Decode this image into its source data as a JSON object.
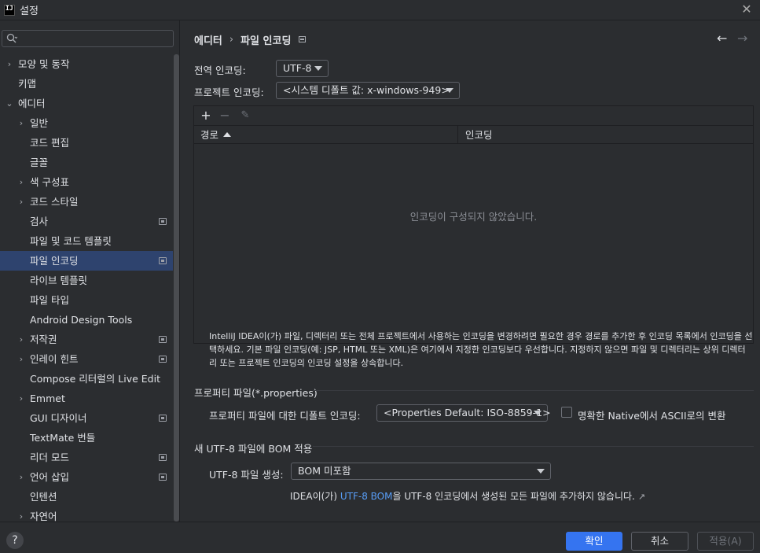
{
  "window": {
    "title": "설정"
  },
  "sidebar": {
    "search_placeholder": "",
    "items": [
      {
        "label": "모양 및 동작",
        "level": 0,
        "chevron": "›",
        "mark": false,
        "selected": false
      },
      {
        "label": "키맵",
        "level": 0,
        "chevron": "",
        "mark": false,
        "selected": false
      },
      {
        "label": "에디터",
        "level": 0,
        "chevron": "⌄",
        "mark": false,
        "selected": false
      },
      {
        "label": "일반",
        "level": 1,
        "chevron": "›",
        "mark": false,
        "selected": false
      },
      {
        "label": "코드 편집",
        "level": 1,
        "chevron": "",
        "mark": false,
        "selected": false
      },
      {
        "label": "글꼴",
        "level": 1,
        "chevron": "",
        "mark": false,
        "selected": false
      },
      {
        "label": "색 구성표",
        "level": 1,
        "chevron": "›",
        "mark": false,
        "selected": false
      },
      {
        "label": "코드 스타일",
        "level": 1,
        "chevron": "›",
        "mark": false,
        "selected": false
      },
      {
        "label": "검사",
        "level": 1,
        "chevron": "",
        "mark": true,
        "selected": false
      },
      {
        "label": "파일 및 코드 템플릿",
        "level": 1,
        "chevron": "",
        "mark": false,
        "selected": false
      },
      {
        "label": "파일 인코딩",
        "level": 1,
        "chevron": "",
        "mark": true,
        "selected": true
      },
      {
        "label": "라이브 템플릿",
        "level": 1,
        "chevron": "",
        "mark": false,
        "selected": false
      },
      {
        "label": "파일 타입",
        "level": 1,
        "chevron": "",
        "mark": false,
        "selected": false
      },
      {
        "label": "Android Design Tools",
        "level": 1,
        "chevron": "",
        "mark": false,
        "selected": false
      },
      {
        "label": "저작권",
        "level": 1,
        "chevron": "›",
        "mark": true,
        "selected": false
      },
      {
        "label": "인레이 힌트",
        "level": 1,
        "chevron": "›",
        "mark": true,
        "selected": false
      },
      {
        "label": "Compose 리터럴의 Live Edit",
        "level": 1,
        "chevron": "",
        "mark": false,
        "selected": false
      },
      {
        "label": "Emmet",
        "level": 1,
        "chevron": "›",
        "mark": false,
        "selected": false
      },
      {
        "label": "GUI 디자이너",
        "level": 1,
        "chevron": "",
        "mark": true,
        "selected": false
      },
      {
        "label": "TextMate 번들",
        "level": 1,
        "chevron": "",
        "mark": false,
        "selected": false
      },
      {
        "label": "리더 모드",
        "level": 1,
        "chevron": "",
        "mark": true,
        "selected": false
      },
      {
        "label": "언어 삽입",
        "level": 1,
        "chevron": "›",
        "mark": true,
        "selected": false
      },
      {
        "label": "인텐션",
        "level": 1,
        "chevron": "",
        "mark": false,
        "selected": false
      },
      {
        "label": "자연어",
        "level": 1,
        "chevron": "›",
        "mark": false,
        "selected": false
      }
    ]
  },
  "breadcrumb": {
    "parent": "에디터",
    "separator": "›",
    "current": "파일 인코딩"
  },
  "encoding": {
    "global_label": "전역 인코딩:",
    "global_value": "UTF-8",
    "project_label": "프로젝트 인코딩:",
    "project_value": "<시스템 디폴트 값: x-windows-949>"
  },
  "table": {
    "add": "+",
    "remove": "−",
    "edit": "✎",
    "col_path": "경로",
    "col_encoding": "인코딩",
    "empty_text": "인코딩이 구성되지 않았습니다."
  },
  "description": "IntelliJ IDEA이(가) 파일, 디렉터리 또는 전체 프로젝트에서 사용하는 인코딩을 변경하려면 필요한 경우 경로를 추가한 후 인코딩 목록에서 인코딩을 선택하세요. 기본 파일 인코딩(예: JSP, HTML 또는 XML)은 여기에서 지정한 인코딩보다 우선합니다. 지정하지 않으면 파일 및 디렉터리는 상위 디렉터리 또는 프로젝트 인코딩의 인코딩 설정을 상속합니다.",
  "properties": {
    "section_title": "프로퍼티 파일(*.properties)",
    "default_label": "프로퍼티 파일에 대한 디폴트 인코딩:",
    "default_value": "<Properties Default: ISO-8859-1>",
    "native_checkbox_label": "명확한 Native에서 ASCII로의 변환"
  },
  "bom": {
    "section_title": "새 UTF-8 파일에 BOM 적용",
    "create_label": "UTF-8 파일 생성:",
    "create_value": "BOM 미포함",
    "note_prefix": "IDEA이(가) ",
    "note_link": "UTF-8 BOM",
    "note_suffix": "을 UTF-8 인코딩에서 생성된 모든 파일에 추가하지 않습니다.",
    "ext_icon": "↗"
  },
  "footer": {
    "help": "?",
    "ok": "확인",
    "cancel": "취소",
    "apply": "적용(A)"
  },
  "colors": {
    "accent": "#3574f0",
    "selection": "#2e436e",
    "link": "#589df6",
    "background": "#2b2d30"
  }
}
